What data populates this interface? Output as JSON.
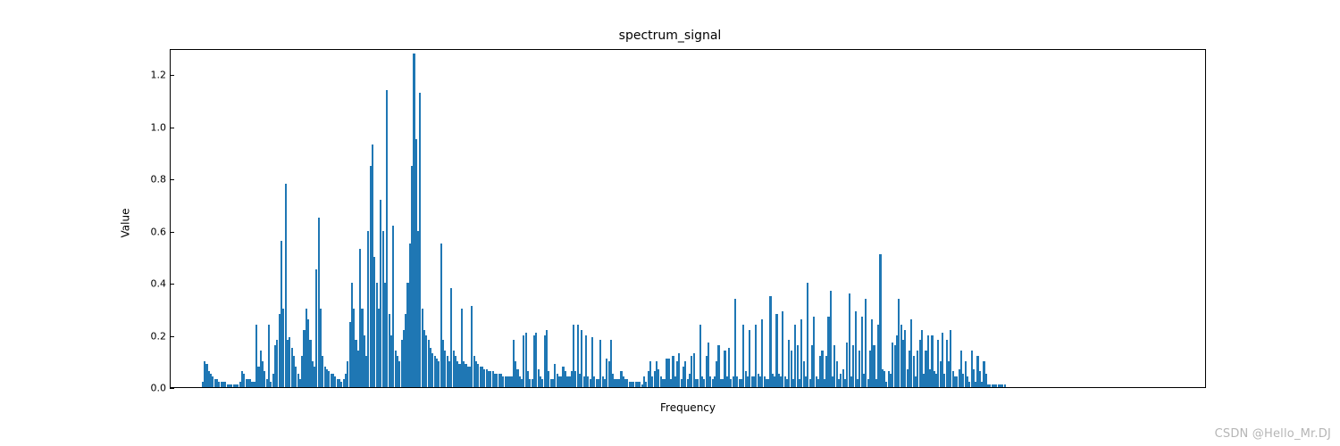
{
  "chart_data": {
    "type": "bar",
    "title": "spectrum_signal",
    "xlabel": "Frequency",
    "ylabel": "Value",
    "ylim": [
      0,
      1.3
    ],
    "yticks": [
      0.0,
      0.2,
      0.4,
      0.6,
      0.8,
      1.0,
      1.2
    ],
    "ytick_labels": [
      "0.0",
      "0.2",
      "0.4",
      "0.6",
      "0.8",
      "1.0",
      "1.2"
    ],
    "color": "#1f77b4",
    "n_points": 500,
    "values": [
      0.0,
      0.0,
      0.0,
      0.0,
      0.0,
      0.0,
      0.0,
      0.0,
      0.0,
      0.0,
      0.0,
      0.0,
      0.0,
      0.0,
      0.0,
      0.02,
      0.1,
      0.09,
      0.06,
      0.05,
      0.04,
      0.03,
      0.03,
      0.02,
      0.02,
      0.02,
      0.02,
      0.01,
      0.01,
      0.01,
      0.01,
      0.01,
      0.01,
      0.02,
      0.06,
      0.05,
      0.03,
      0.03,
      0.03,
      0.02,
      0.02,
      0.24,
      0.08,
      0.14,
      0.1,
      0.06,
      0.03,
      0.24,
      0.02,
      0.05,
      0.16,
      0.18,
      0.28,
      0.56,
      0.3,
      0.78,
      0.18,
      0.19,
      0.15,
      0.12,
      0.08,
      0.05,
      0.03,
      0.12,
      0.22,
      0.3,
      0.26,
      0.18,
      0.1,
      0.08,
      0.45,
      0.65,
      0.3,
      0.12,
      0.08,
      0.07,
      0.06,
      0.05,
      0.05,
      0.04,
      0.03,
      0.03,
      0.02,
      0.03,
      0.05,
      0.1,
      0.25,
      0.4,
      0.3,
      0.18,
      0.14,
      0.53,
      0.3,
      0.2,
      0.12,
      0.6,
      0.85,
      0.93,
      0.5,
      0.4,
      0.3,
      0.72,
      0.6,
      0.4,
      1.14,
      0.28,
      0.2,
      0.62,
      0.14,
      0.12,
      0.1,
      0.18,
      0.22,
      0.28,
      0.4,
      0.55,
      0.85,
      1.28,
      0.95,
      0.6,
      1.13,
      0.3,
      0.22,
      0.2,
      0.18,
      0.15,
      0.13,
      0.12,
      0.11,
      0.1,
      0.55,
      0.18,
      0.14,
      0.12,
      0.1,
      0.38,
      0.14,
      0.12,
      0.1,
      0.09,
      0.3,
      0.1,
      0.09,
      0.08,
      0.08,
      0.31,
      0.12,
      0.1,
      0.09,
      0.08,
      0.08,
      0.07,
      0.07,
      0.06,
      0.06,
      0.06,
      0.05,
      0.05,
      0.05,
      0.05,
      0.04,
      0.04,
      0.04,
      0.04,
      0.04,
      0.18,
      0.1,
      0.07,
      0.04,
      0.03,
      0.2,
      0.21,
      0.06,
      0.03,
      0.03,
      0.2,
      0.21,
      0.07,
      0.04,
      0.03,
      0.2,
      0.22,
      0.06,
      0.03,
      0.03,
      0.09,
      0.05,
      0.04,
      0.04,
      0.08,
      0.06,
      0.04,
      0.04,
      0.06,
      0.24,
      0.06,
      0.24,
      0.05,
      0.22,
      0.04,
      0.2,
      0.04,
      0.03,
      0.19,
      0.04,
      0.03,
      0.03,
      0.18,
      0.04,
      0.03,
      0.11,
      0.1,
      0.18,
      0.05,
      0.03,
      0.03,
      0.03,
      0.06,
      0.04,
      0.03,
      0.03,
      0.02,
      0.02,
      0.02,
      0.02,
      0.02,
      0.02,
      0.01,
      0.04,
      0.02,
      0.06,
      0.1,
      0.04,
      0.06,
      0.1,
      0.07,
      0.04,
      0.03,
      0.03,
      0.11,
      0.11,
      0.03,
      0.12,
      0.04,
      0.1,
      0.13,
      0.03,
      0.08,
      0.1,
      0.03,
      0.05,
      0.12,
      0.13,
      0.03,
      0.03,
      0.24,
      0.04,
      0.03,
      0.12,
      0.17,
      0.04,
      0.03,
      0.04,
      0.1,
      0.16,
      0.03,
      0.03,
      0.14,
      0.04,
      0.15,
      0.03,
      0.04,
      0.34,
      0.04,
      0.03,
      0.03,
      0.24,
      0.06,
      0.04,
      0.22,
      0.04,
      0.04,
      0.24,
      0.05,
      0.04,
      0.26,
      0.04,
      0.03,
      0.03,
      0.35,
      0.05,
      0.04,
      0.28,
      0.05,
      0.04,
      0.29,
      0.04,
      0.03,
      0.18,
      0.14,
      0.03,
      0.24,
      0.16,
      0.03,
      0.26,
      0.1,
      0.04,
      0.4,
      0.03,
      0.16,
      0.27,
      0.04,
      0.03,
      0.12,
      0.14,
      0.03,
      0.12,
      0.27,
      0.37,
      0.04,
      0.16,
      0.1,
      0.03,
      0.05,
      0.07,
      0.03,
      0.17,
      0.36,
      0.04,
      0.16,
      0.29,
      0.03,
      0.14,
      0.27,
      0.05,
      0.34,
      0.03,
      0.14,
      0.26,
      0.16,
      0.03,
      0.24,
      0.51,
      0.07,
      0.06,
      0.02,
      0.06,
      0.05,
      0.17,
      0.16,
      0.2,
      0.34,
      0.24,
      0.18,
      0.22,
      0.07,
      0.14,
      0.26,
      0.12,
      0.04,
      0.14,
      0.18,
      0.22,
      0.05,
      0.14,
      0.2,
      0.07,
      0.2,
      0.06,
      0.05,
      0.18,
      0.1,
      0.21,
      0.05,
      0.18,
      0.1,
      0.22,
      0.06,
      0.04,
      0.04,
      0.07,
      0.14,
      0.05,
      0.1,
      0.04,
      0.02,
      0.14,
      0.07,
      0.02,
      0.12,
      0.06,
      0.02,
      0.1,
      0.05,
      0.01,
      0.01,
      0.01,
      0.01,
      0.01,
      0.01,
      0.01,
      0.01,
      0.01,
      0.0,
      0.0,
      0.0,
      0.0,
      0.0,
      0.0,
      0.0,
      0.0,
      0.0,
      0.0,
      0.0,
      0.0,
      0.0,
      0.0,
      0.0,
      0.0,
      0.0,
      0.0,
      0.0,
      0.0,
      0.0,
      0.0,
      0.0,
      0.0,
      0.0,
      0.0,
      0.0,
      0.0,
      0.0,
      0.0,
      0.0,
      0.0,
      0.0,
      0.0,
      0.0,
      0.0,
      0.0,
      0.0,
      0.0,
      0.0,
      0.0,
      0.0,
      0.0,
      0.0,
      0.0,
      0.0,
      0.0,
      0.0,
      0.0,
      0.0,
      0.0,
      0.0,
      0.0,
      0.0,
      0.0,
      0.0,
      0.0,
      0.0,
      0.0,
      0.0,
      0.0,
      0.0,
      0.0,
      0.0,
      0.0,
      0.0,
      0.0,
      0.0,
      0.0,
      0.0,
      0.0,
      0.0,
      0.0,
      0.0,
      0.0,
      0.0,
      0.0,
      0.0,
      0.0,
      0.0,
      0.0,
      0.0,
      0.0,
      0.0,
      0.0,
      0.0,
      0.0,
      0.0,
      0.0,
      0.0,
      0.0,
      0.0,
      0.0,
      0.0,
      0.0,
      0.0,
      0.0
    ]
  },
  "watermark": "CSDN @Hello_Mr.DJ"
}
